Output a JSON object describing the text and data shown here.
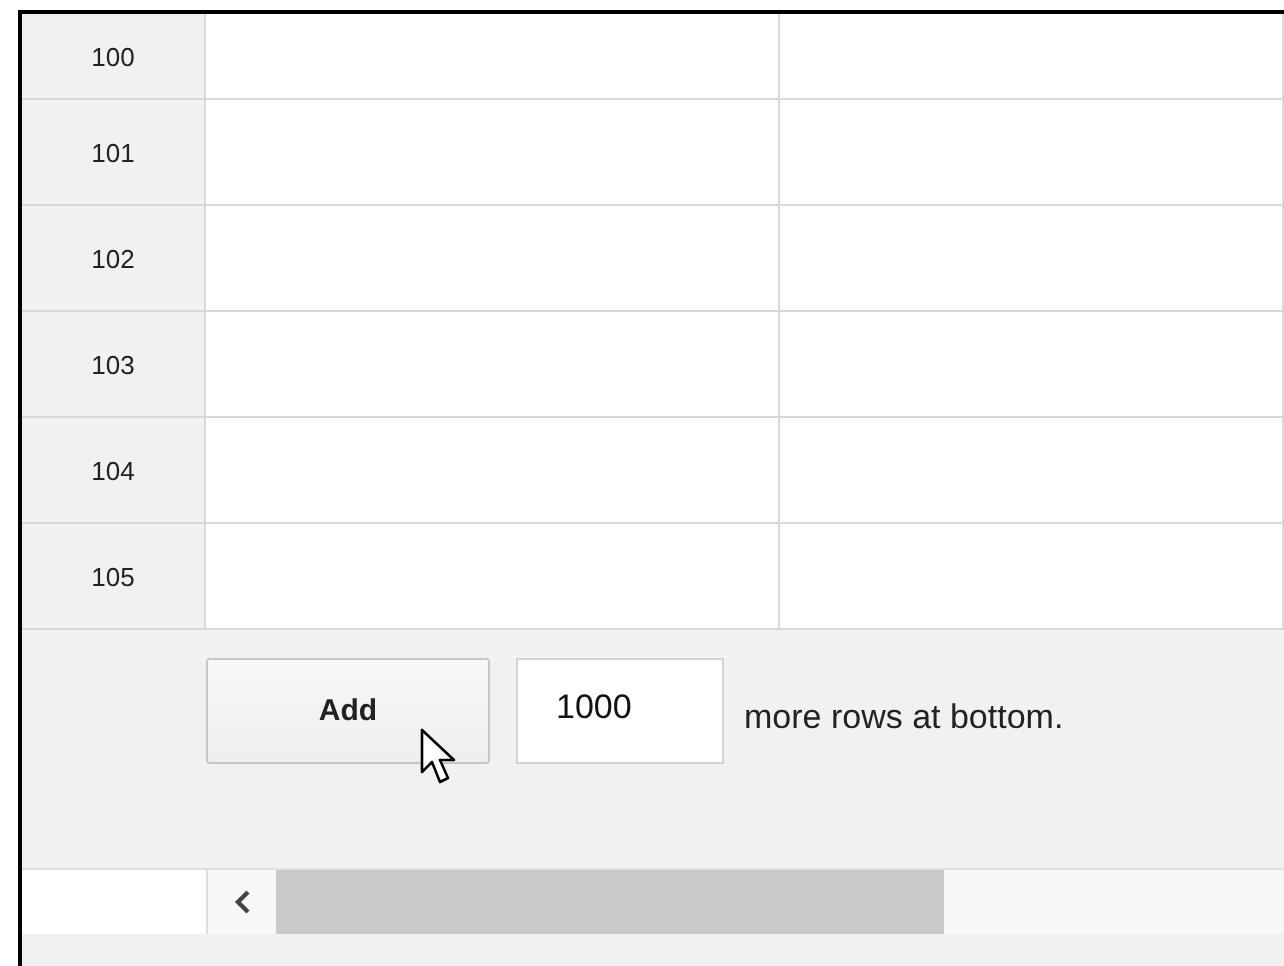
{
  "rows": [
    {
      "number": "100"
    },
    {
      "number": "101"
    },
    {
      "number": "102"
    },
    {
      "number": "103"
    },
    {
      "number": "104"
    },
    {
      "number": "105"
    }
  ],
  "add_rows": {
    "button": "Add",
    "count": "1000",
    "suffix": "more rows at bottom."
  }
}
